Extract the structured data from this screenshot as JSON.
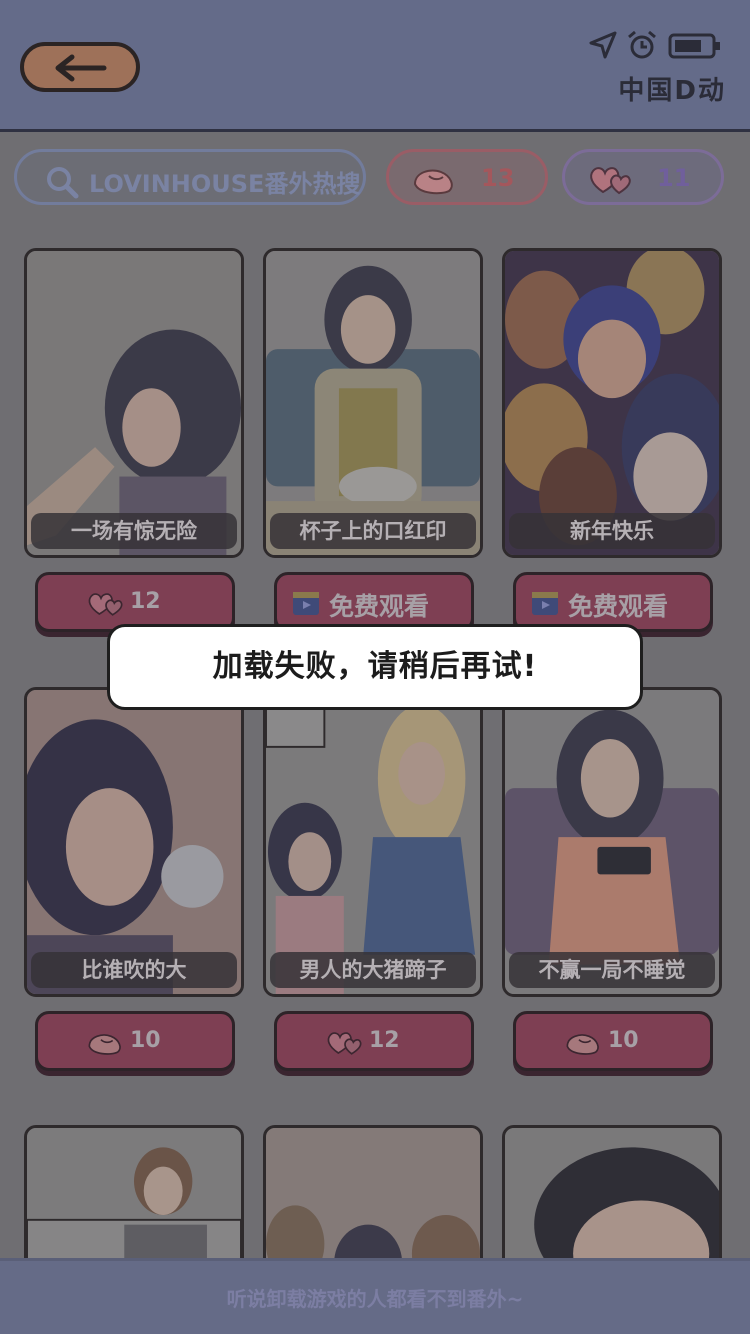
{
  "header": {
    "back_icon": "left-arrow-icon",
    "status_icons": [
      "location-arrow-icon",
      "alarm-clock-icon",
      "battery-icon"
    ],
    "carrier": "中国D动"
  },
  "toolbar": {
    "search_label": "LOVINHOUSE番外热搜",
    "meat_count": "13",
    "heart_count": "11"
  },
  "cards": [
    {
      "title": "一场有惊无险"
    },
    {
      "title": "杯子上的口红印"
    },
    {
      "title": "新年快乐"
    },
    {
      "title": "比谁吹的大"
    },
    {
      "title": "男人的大猪蹄子"
    },
    {
      "title": "不赢一局不睡觉"
    },
    {
      "title": ""
    },
    {
      "title": ""
    },
    {
      "title": ""
    }
  ],
  "buttons": [
    {
      "type": "heart",
      "label": "12"
    },
    {
      "type": "video",
      "label": "免费观看"
    },
    {
      "type": "video",
      "label": "免费观看"
    },
    {
      "type": "meat",
      "label": "10"
    },
    {
      "type": "heart",
      "label": "12"
    },
    {
      "type": "meat",
      "label": "10"
    }
  ],
  "toast": "加载失败，请稍后再试!",
  "footer": "听说卸载游戏的人都看不到番外~",
  "colors": {
    "overlay": "#6f6e72",
    "header": "#646b89",
    "button": "#7e3f53",
    "toast_bg": "#ffffff"
  }
}
